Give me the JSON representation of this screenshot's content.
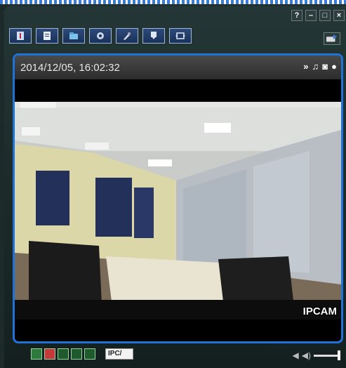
{
  "window_controls": {
    "help": "?",
    "minimize": "–",
    "maximize": "□",
    "close": "×"
  },
  "toolbar": {
    "buttons": [
      {
        "icon": "info-icon"
      },
      {
        "icon": "document-icon"
      },
      {
        "icon": "folder-icon"
      },
      {
        "icon": "settings-icon"
      },
      {
        "icon": "tools-icon"
      },
      {
        "icon": "download-icon"
      },
      {
        "icon": "resize-icon"
      }
    ],
    "tray_icon": "export-icon"
  },
  "video": {
    "timestamp": "2014/12/05, 16:02:32",
    "camera_label": "IPCAM",
    "header_icons": [
      "forward-icon",
      "headphones-icon",
      "camera-icon",
      "chat-icon"
    ]
  },
  "bottom_bar": {
    "camera_tab": "IPC/",
    "layouts": [
      "grid-4-icon",
      "grid-1-icon",
      "grid-2-icon",
      "grid-3-icon",
      "fullscreen-icon"
    ],
    "volume_level": 1.0
  },
  "colors": {
    "accent": "#1f73d6",
    "background": "#1c2a2a"
  }
}
